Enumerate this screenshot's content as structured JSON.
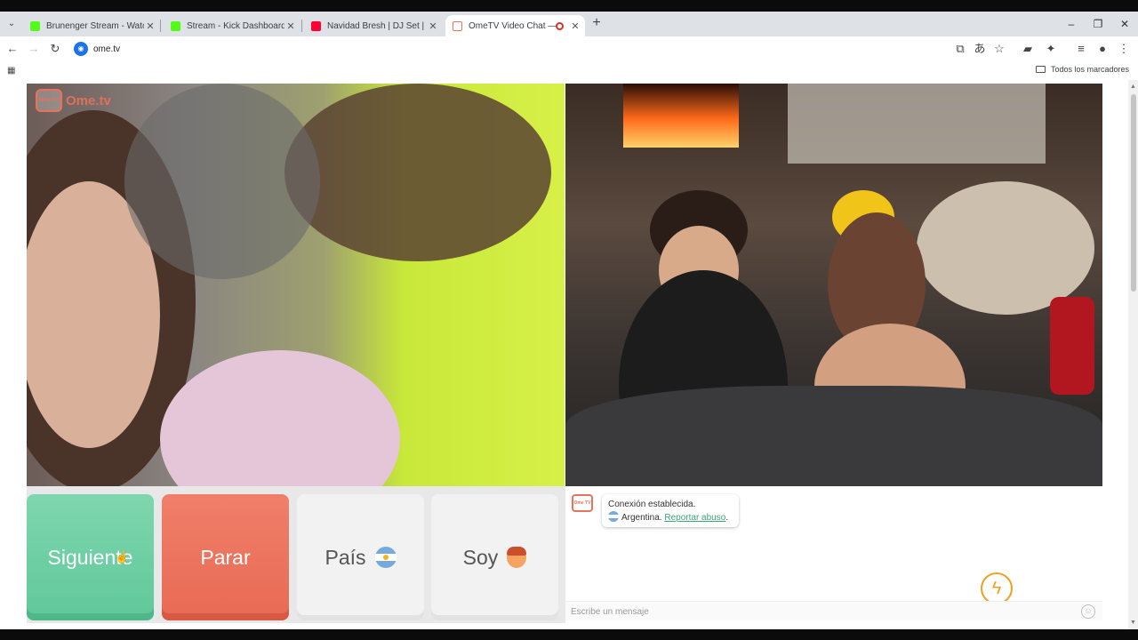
{
  "browser": {
    "tabs": [
      {
        "title": "Brunenger Stream - Watch Live",
        "favicon_color": "#53fc18"
      },
      {
        "title": "Stream - Kick Dashboard",
        "favicon_color": "#53fc18"
      },
      {
        "title": "Navidad Bresh | DJ Set | Fiesta",
        "favicon_color": "#ff0033"
      },
      {
        "title": "OmeTV Video Chat — Ome",
        "favicon_color": "#e8725c"
      }
    ],
    "active_tab_index": 3,
    "tab_close_glyph": "✕",
    "new_tab_glyph": "+",
    "url": "ome.tv",
    "bookmarks_all_label": "Todos los marcadores"
  },
  "page": {
    "logo_text": "Ome.tv",
    "logo_badge": "Ome TV",
    "buttons": {
      "next_label": "Siguiente",
      "stop_label": "Parar",
      "country_label": "País",
      "gender_label": "Soy"
    },
    "chat": {
      "icon_text": "Ome TV",
      "status_message": "Conexión establecida.",
      "country": "Argentina.",
      "report_link": "Reportar abuso",
      "report_suffix": ".",
      "input_placeholder": "Escribe un mensaje"
    },
    "colors": {
      "next": "#5fc89a",
      "stop": "#e86a54",
      "brand": "#e8725c"
    }
  }
}
